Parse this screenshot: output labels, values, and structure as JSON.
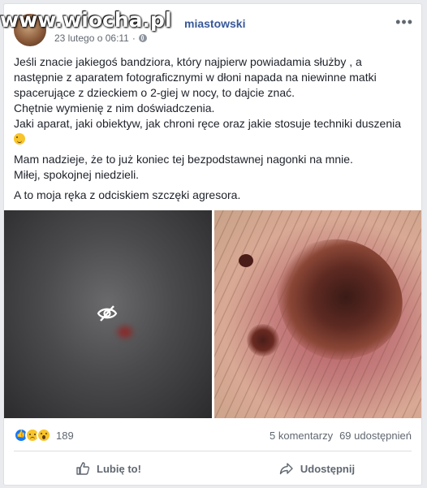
{
  "watermark": "www.wiocha.pl",
  "post": {
    "author": "miastowski",
    "date": "23 lutego o 06:11",
    "separator": "·",
    "paragraphs": [
      {
        "lines": [
          "Jeśli znacie jakiegoś bandziora, który najpierw powiadamia służby , a",
          "następnie z aparatem fotograficznymi w dłoni napada na niewinne matki",
          "spacerujące z dzieckiem o 2-giej w nocy, to dajcie znać.",
          "Chętnie wymienię z nim doświadczenia.",
          "Jaki aparat, jaki obiektyw, jak chroni ręce oraz jakie stosuje techniki duszenia"
        ]
      },
      {
        "lines": [
          "Mam nadzieje, że to już koniec tej bezpodstawnej nagonki na mnie.",
          "Miłej, spokojnej niedzieli."
        ]
      },
      {
        "lines": [
          "A to moja ręka z odciskiem szczęki agresora."
        ]
      }
    ]
  },
  "footer": {
    "reaction_count": "189",
    "comments": "5 komentarzy",
    "shares": "69 udostępnień",
    "like_label": "Lubię to!",
    "share_label": "Udostępnij"
  },
  "colors": {
    "link": "#385898",
    "text": "#1d2129",
    "muted": "#606770",
    "like_blue": "#1877f2"
  },
  "icons": [
    "more-options-icon",
    "globe-icon",
    "hidden-eye-icon",
    "like-reaction-icon",
    "sad-reaction-icon",
    "wow-reaction-icon",
    "thumbs-up-icon",
    "share-arrow-icon",
    "wink-emoji-icon"
  ]
}
